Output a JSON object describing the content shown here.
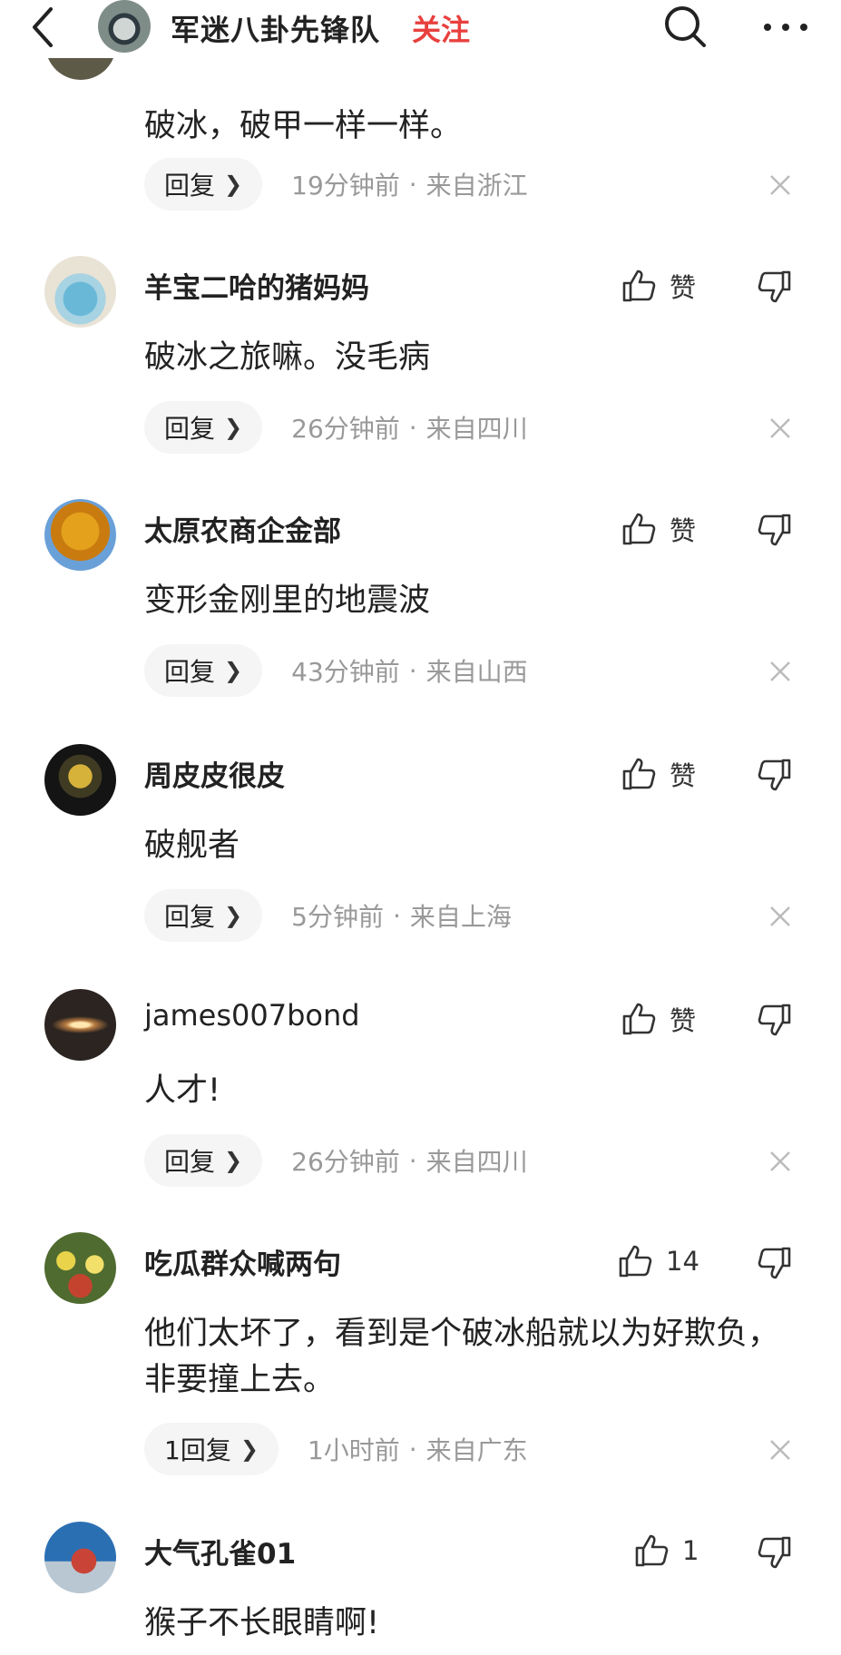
{
  "header": {
    "title": "军迷八卦先锋队",
    "follow_label": "关注"
  },
  "top_comment": {
    "text": "破冰，破甲一样一样。",
    "reply_label": "回复",
    "time": "19分钟前",
    "location": "来自浙江"
  },
  "comments": [
    {
      "name": "羊宝二哈的猪妈妈",
      "like_label": "赞",
      "text": "破冰之旅嘛。没毛病",
      "reply_label": "回复",
      "time": "26分钟前",
      "location": "来自四川"
    },
    {
      "name": "太原农商企金部",
      "like_label": "赞",
      "text": "变形金刚里的地震波",
      "reply_label": "回复",
      "time": "43分钟前",
      "location": "来自山西"
    },
    {
      "name": "周皮皮很皮",
      "like_label": "赞",
      "text": "破舰者",
      "reply_label": "回复",
      "time": "5分钟前",
      "location": "来自上海"
    },
    {
      "name": "james007bond",
      "like_label": "赞",
      "text": "人才!",
      "reply_label": "回复",
      "time": "26分钟前",
      "location": "来自四川"
    },
    {
      "name": "吃瓜群众喊两句",
      "like_label": "14",
      "text": "他们太坏了，看到是个破冰船就以为好欺负，非要撞上去。",
      "reply_label": "1回复",
      "time": "1小时前",
      "location": "来自广东"
    },
    {
      "name": "大气孔雀01",
      "like_label": "1",
      "text": "猴子不长眼睛啊!"
    }
  ],
  "icons": {
    "back": "chevron-left-icon",
    "search": "search-icon",
    "more": "more-icon",
    "like": "thumbs-up-icon",
    "dislike": "thumbs-down-icon",
    "close": "close-icon"
  },
  "colors": {
    "follow": "#e8403e",
    "meta": "#999999"
  }
}
